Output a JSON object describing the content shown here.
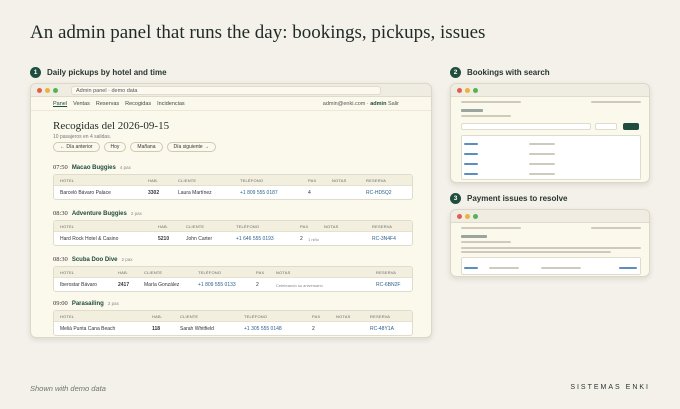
{
  "headline": "An admin panel that runs the day: bookings, pickups, issues",
  "steps": [
    {
      "num": "1",
      "label": "Daily pickups by hotel and time"
    },
    {
      "num": "2",
      "label": "Bookings with search"
    },
    {
      "num": "3",
      "label": "Payment issues to resolve"
    }
  ],
  "main": {
    "url": "Admin panel · demo data",
    "nav": [
      "Panel",
      "Ventas",
      "Reservas",
      "Recogidas",
      "Incidencias"
    ],
    "account_email": "admin@enki.com",
    "account_sep": "·",
    "account_user": "admin",
    "logout": "Salir",
    "title": "Recogidas del 2026-09-15",
    "subtitle": "10 pasajeros en 4 salidas.",
    "buttons": [
      "← Día anterior",
      "Hoy",
      "Mañana",
      "Día siguiente →"
    ],
    "groups": [
      {
        "time": "07:50",
        "name": "Macao Buggies",
        "count": "4 pax",
        "headers": [
          "HOTEL",
          "HAB.",
          "CLIENTE",
          "TELÉFONO",
          "PAX",
          "NOTAS",
          "RESERVA"
        ],
        "row": [
          "Barceló Bávaro Palace",
          "3302",
          "Laura Martínez",
          "+1 809 555 0187",
          "4",
          "",
          "RC-HD5Q2"
        ]
      },
      {
        "time": "08:30",
        "name": "Adventure Buggies",
        "count": "2 pax",
        "headers": [
          "HOTEL",
          "HAB.",
          "CLIENTE",
          "TELÉFONO",
          "PAX",
          "NOTAS",
          "RESERVA"
        ],
        "row": [
          "Hard Rock Hotel & Casino",
          "5210",
          "John Carter",
          "+1 646 555 0193",
          "2",
          "1 niño",
          "RC-3N4F4"
        ]
      },
      {
        "time": "08:30",
        "name": "Scuba Doo Dive",
        "count": "2 pax",
        "headers": [
          "HOTEL",
          "HAB.",
          "CLIENTE",
          "TELÉFONO",
          "PAX",
          "NOTAS",
          "RESERVA"
        ],
        "row": [
          "Iberostar Bávaro",
          "2417",
          "María González",
          "+1 809 555 0133",
          "2",
          "Celebrando su aniversario",
          "RC-6BN2F"
        ]
      },
      {
        "time": "09:00",
        "name": "Parasailing",
        "count": "2 pax",
        "headers": [
          "HOTEL",
          "HAB.",
          "CLIENTE",
          "TELÉFONO",
          "PAX",
          "NOTAS",
          "RESERVA"
        ],
        "row": [
          "Meliá Punta Cana Beach",
          "118",
          "Sarah Whitfield",
          "+1 305 555 0148",
          "2",
          "",
          "RC-48Y1A"
        ]
      }
    ]
  },
  "footer": {
    "left": "Shown with demo data",
    "right": "SISTEMAS ENKI"
  },
  "colors": {
    "background": "#f3f1e9",
    "accent": "#1f4d3f",
    "link": "#2c5e8a",
    "window": "#fbf8ec"
  },
  "icons": [
    "close-dot-icon",
    "minimize-dot-icon",
    "maximize-dot-icon"
  ]
}
